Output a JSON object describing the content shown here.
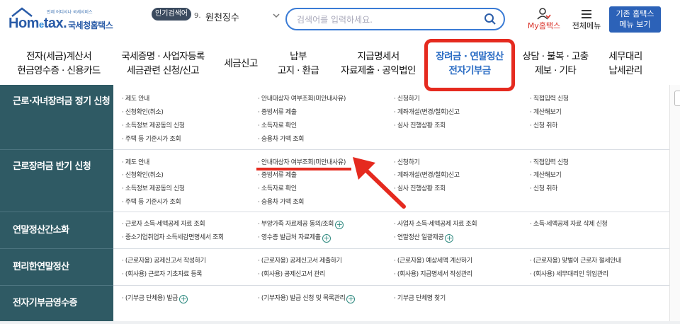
{
  "header": {
    "logo_small": "언제 어디서나 국세서비스",
    "logo_word_1": "Hom",
    "logo_word_e": "e",
    "logo_word_2": "tax.",
    "logo_kr": "국세청홈택스",
    "popular_badge": "인기검색어",
    "popular_rank": "9.",
    "popular_item": "원천징수",
    "search_placeholder": "검색어를 입력하세요.",
    "mytax_label": "My홈택스",
    "menu_all_label": "전체메뉴",
    "old_btn_line1": "기존 홈택스",
    "old_btn_line2": "메뉴 보기",
    "icons": {
      "search": "search-icon",
      "user": "user-icon",
      "menu": "hamburger-icon",
      "chevron": "chevron-down-icon"
    }
  },
  "nav": [
    {
      "l1": "전자(세금)계산서",
      "l2": "현금영수증 · 신용카드"
    },
    {
      "l1": "국세증명 · 사업자등록",
      "l2": "세금관련 신청/신고"
    },
    {
      "l1": "세금신고",
      "l2": ""
    },
    {
      "l1": "납부",
      "l2": "고지 · 환급"
    },
    {
      "l1": "지급명세서",
      "l2": "자료제출 · 공익법인"
    },
    {
      "l1": "장려금 · 연말정산",
      "l2": "전자기부금"
    },
    {
      "l1": "상담 · 불복 · 고충",
      "l2": "제보 · 기타"
    },
    {
      "l1": "세무대리",
      "l2": "납세관리"
    }
  ],
  "rows": [
    {
      "title": "근로·자녀장려금 정기 신청",
      "cells": [
        [
          "· 제도 안내",
          "· 신청확인(취소)",
          "· 소득정보 제공동의 신청",
          "· 주택 등 기준시가 조회"
        ],
        [
          "· 안내대상자 여부조회(미안내사유)",
          "· 증빙서류 제출",
          "· 소득자료 확인",
          "· 승용차 가액 조회"
        ],
        [
          "· 신청하기",
          "· 계좌개설(변경/철회)신고",
          "· 심사 진행상황 조회"
        ],
        [
          "· 직접입력 신청",
          "· 계산해보기",
          "· 신청 취하"
        ]
      ]
    },
    {
      "title": "근로장려금 반기 신청",
      "cells": [
        [
          "· 제도 안내",
          "· 신청확인(취소)",
          "· 소득정보 제공동의 신청",
          "· 주택 등 기준시가 조회"
        ],
        [
          "· 안내대상자 여부조회(미안내사유)",
          "· 증빙서류 제출",
          "· 소득자료 확인",
          "· 승용차 가액 조회"
        ],
        [
          "· 신청하기",
          "· 계좌개설(변경/철회)신고",
          "· 심사 진행상황 조회"
        ],
        [
          "· 직접입력 신청",
          "· 계산해보기",
          "· 신청 취하"
        ]
      ]
    },
    {
      "title": "연말정산간소화",
      "cells": [
        [
          "· 근로자 소득·세액공제 자료 조회",
          "· 중소기업취업자 소득세감면명세서 조회"
        ],
        [
          "· 부양가족 자료제공 동의/조회",
          "· 영수증 발급처 자료제출"
        ],
        [
          "· 사업자 소득·세액공제 자료 조회",
          "· 연말정산 일괄제공"
        ],
        [
          "· 소득·세액공제 자료 삭제 신청"
        ]
      ]
    },
    {
      "title": "편리한연말정산",
      "cells": [
        [
          "· (근로자용) 공제신고서 작성하기",
          "· (회사용) 근로자 기초자료 등록"
        ],
        [
          "· (근로자용) 공제신고서 제출하기",
          "· (회사용) 공제신고서 관리"
        ],
        [
          "· (근로자용) 예상세액 계산하기",
          "· (회사용) 지급명세서 작성관리"
        ],
        [
          "· (근로자용) 맞벌이 근로자 절세안내",
          "· (회사용) 세무대리인 위임관리"
        ]
      ]
    },
    {
      "title": "전자기부금영수증",
      "cells": [
        [
          "· (기부금 단체용) 발급"
        ],
        [
          "· (기부자용) 발급 신청 및 목록관리"
        ],
        [
          "· 기부금 단체명 찾기"
        ],
        []
      ]
    }
  ],
  "colors": {
    "row_header_bg": "#2f5a64",
    "accent_blue": "#2a6cc4",
    "highlight_red": "#e52a1f"
  }
}
